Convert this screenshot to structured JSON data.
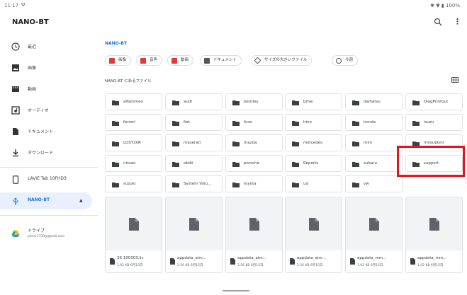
{
  "status": {
    "time": "11:17",
    "battery": "100%"
  },
  "app": {
    "title": "NANO-BT"
  },
  "sidebar": {
    "items": [
      {
        "label": "最近",
        "icon": "clock-icon"
      },
      {
        "label": "画像",
        "icon": "image-icon"
      },
      {
        "label": "動画",
        "icon": "video-icon"
      },
      {
        "label": "オーディオ",
        "icon": "audio-icon"
      },
      {
        "label": "ドキュメント",
        "icon": "document-icon"
      },
      {
        "label": "ダウンロード",
        "icon": "download-icon"
      }
    ],
    "devices": [
      {
        "label": "LAVIE Tab 10FHD3",
        "icon": "tablet-icon"
      },
      {
        "label": "NANO-BT",
        "icon": "usb-icon"
      }
    ],
    "drive": {
      "label": "ドライブ",
      "account": "pliner1733@gmail.com"
    }
  },
  "main": {
    "breadcrumb": "NANO-BT",
    "chips": [
      {
        "label": "画像",
        "color": "#e53935"
      },
      {
        "label": "音声",
        "color": "#e53935"
      },
      {
        "label": "動画",
        "color": "#e53935"
      },
      {
        "label": "ドキュメント",
        "color": "#555555"
      },
      {
        "label": "サイズの大きいファイル",
        "color": "#555555"
      },
      {
        "label": "今週",
        "color": "#555555"
      }
    ],
    "section_title": "NANO-BT にあるファイル",
    "folders": [
      "alfaromeo",
      "audi",
      "bentley",
      "bmw",
      "daihatsu",
      "DiagPrintout",
      "ferrari",
      "fiat",
      "fuso",
      "hino",
      "honda",
      "isuzu",
      "LOST.DIR",
      "maserati",
      "mazda",
      "mercedes",
      "mini",
      "mitsubishi",
      "nissan",
      "obdii",
      "porsche",
      "Reports",
      "subaru",
      "support",
      "suzuki",
      "System Volu...",
      "toyota",
      "ud",
      "vw"
    ],
    "files": [
      {
        "name": "36 100303.lic",
        "size": "1.02 KB 6月15日"
      },
      {
        "name": "appdata_aim...",
        "size": "2.56 KB 6月15日"
      },
      {
        "name": "appdata_aim...",
        "size": "2.56 KB 6月15日"
      },
      {
        "name": "appdata_aim...",
        "size": "2.56 KB 6月15日"
      },
      {
        "name": "appdata_mm...",
        "size": "1.02 KB 6月15日"
      },
      {
        "name": "appdata_mm...",
        "size": "1.92 KB 6月15日"
      }
    ]
  },
  "colors": {
    "accent": "#1a73e8",
    "highlight": "#e8141b"
  }
}
